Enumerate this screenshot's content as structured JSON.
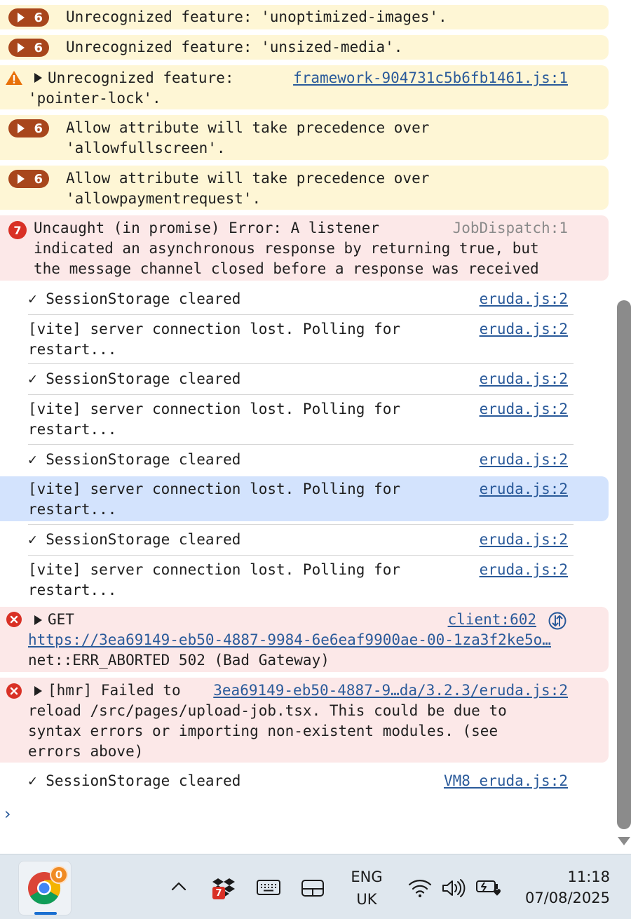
{
  "messages": {
    "w1": {
      "count": "6",
      "text": "Unrecognized feature: 'unoptimized-images'."
    },
    "w2": {
      "count": "6",
      "text": "Unrecognized feature: 'unsized-media'."
    },
    "w3": {
      "line1": "Unrecognized feature:",
      "line2": "'pointer-lock'.",
      "source": "framework-904731c5b6fb1461.js:1"
    },
    "w4": {
      "count": "6",
      "line1": "Allow attribute will take precedence over",
      "line2": "'allowfullscreen'."
    },
    "w5": {
      "count": "6",
      "line1": "Allow attribute will take precedence over",
      "line2": "'allowpaymentrequest'."
    },
    "e1": {
      "count": "7",
      "line1": "Uncaught (in promise) Error: A listener",
      "line2": "indicated an asynchronous response by returning true, but",
      "line3": "the message channel closed before a response was received",
      "source": "JobDispatch:1"
    },
    "logs": [
      {
        "text": "✓ SessionStorage cleared",
        "source": "eruda.js:2"
      },
      {
        "line1": "[vite] server connection lost. Polling for",
        "line2": "restart...",
        "source": "eruda.js:2"
      },
      {
        "text": "✓ SessionStorage cleared",
        "source": "eruda.js:2"
      },
      {
        "line1": "[vite] server connection lost. Polling for",
        "line2": "restart...",
        "source": "eruda.js:2"
      },
      {
        "text": "✓ SessionStorage cleared",
        "source": "eruda.js:2"
      },
      {
        "line1": "[vite] server connection lost. Polling for",
        "line2": "restart...",
        "source": "eruda.js:2"
      },
      {
        "text": "✓ SessionStorage cleared",
        "source": "eruda.js:2"
      },
      {
        "line1": "[vite] server connection lost. Polling for",
        "line2": "restart...",
        "source": "eruda.js:2"
      }
    ],
    "e2": {
      "method": "GET",
      "url": "https://3ea69149-eb50-4887-9984-6e6eaf9900ae-00-1za3f2ke5o…",
      "status": "net::ERR_ABORTED 502 (Bad Gateway)",
      "source": "client:602"
    },
    "e3": {
      "line1": "[hmr] Failed to",
      "line2": "reload /src/pages/upload-job.tsx. This could be due to",
      "line3": "syntax errors or importing non-existent modules. (see",
      "line4": "errors above)",
      "source": "3ea69149-eb50-4887-9…da/3.2.3/eruda.js:2"
    },
    "last": {
      "text": "✓ SessionStorage cleared",
      "source": "VM8 eruda.js:2"
    }
  },
  "prompt": "›",
  "taskbar": {
    "chrome_badge": "0",
    "dropbox_badge": "7",
    "language_line1": "ENG",
    "language_line2": "UK",
    "time": "11:18",
    "date": "07/08/2025"
  },
  "colors": {
    "warning_bg": "#fef6d5",
    "error_bg": "#fce8e8",
    "selected_bg": "#d3e3fd",
    "badge": "#a8461c",
    "error_icon": "#d93025",
    "link": "#2a5a9a"
  }
}
